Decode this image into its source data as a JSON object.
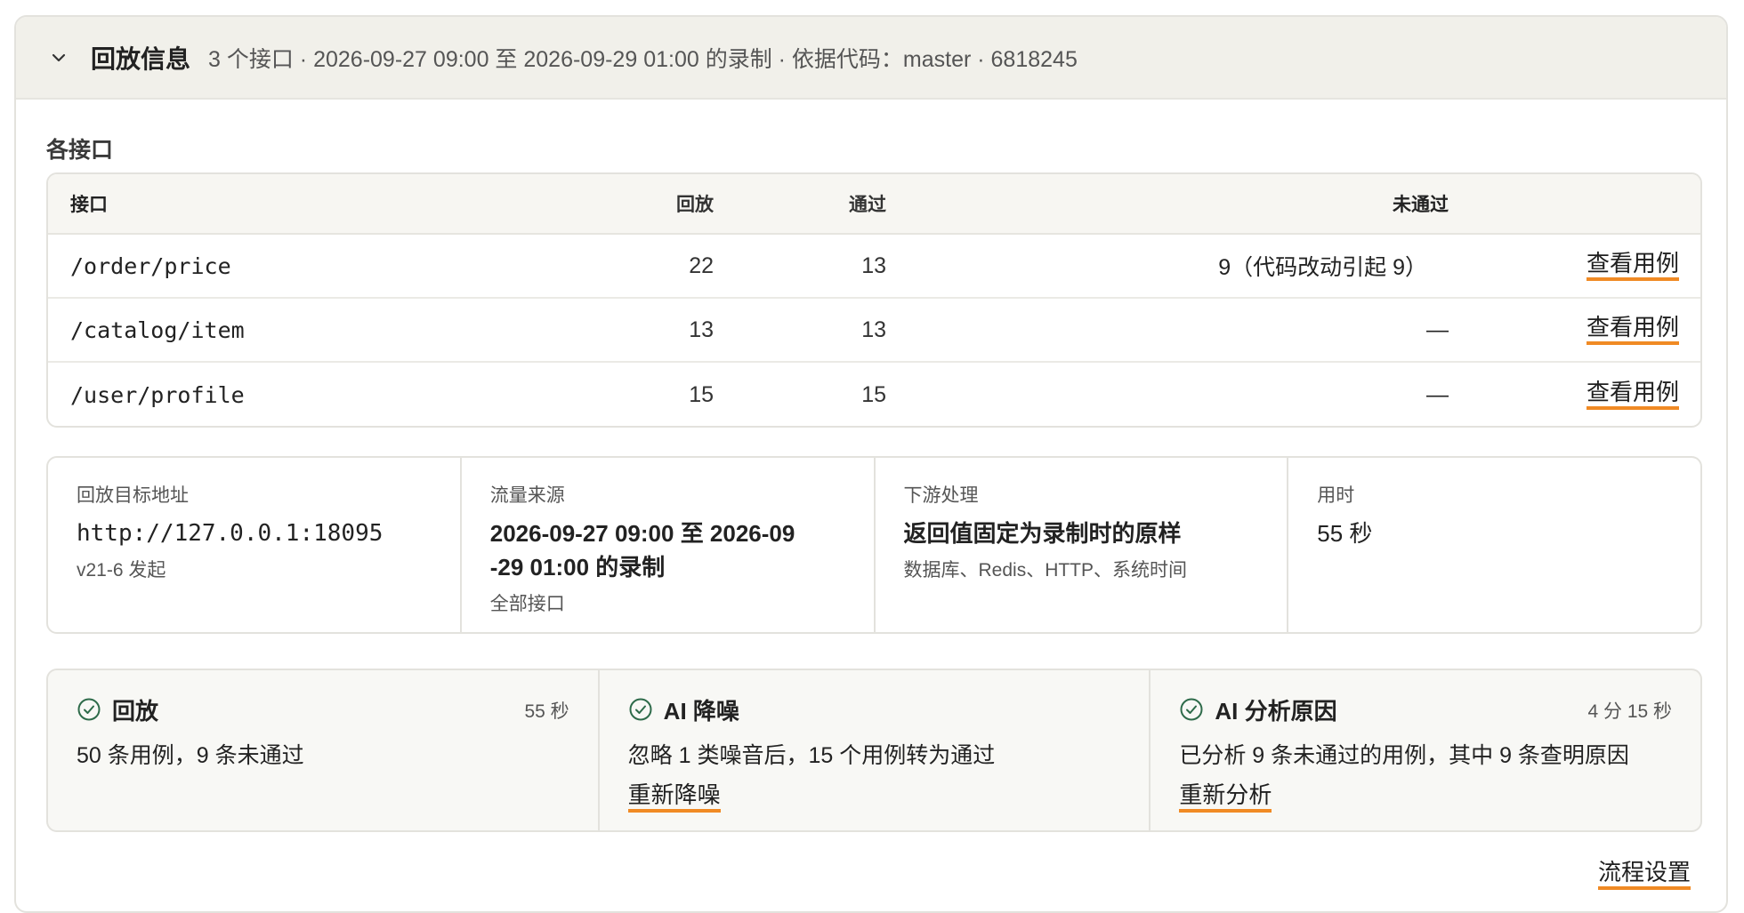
{
  "header": {
    "title": "回放信息",
    "subtitle": "3 个接口 · 2026-09-27 09:00 至 2026-09-29 01:00 的录制 · 依据代码：master · 6818245"
  },
  "apis_section": {
    "label": "各接口",
    "columns": [
      "接口",
      "回放",
      "通过",
      "未通过"
    ],
    "rows": [
      {
        "api": "/order/price",
        "replay": "22",
        "pass": "13",
        "fail": "9（代码改动引起 9）",
        "action": "查看用例"
      },
      {
        "api": "/catalog/item",
        "replay": "13",
        "pass": "13",
        "fail": "—",
        "action": "查看用例"
      },
      {
        "api": "/user/profile",
        "replay": "15",
        "pass": "15",
        "fail": "—",
        "action": "查看用例"
      }
    ]
  },
  "info": {
    "target": {
      "label": "回放目标地址",
      "value": "http://127.0.0.1:18095",
      "sub": "v21-6 发起"
    },
    "source": {
      "label": "流量来源",
      "value_line1": "2026-09-27 09:00 至 2026-09",
      "value_line2": "-29 01:00 的录制",
      "sub": "全部接口"
    },
    "downstream": {
      "label": "下游处理",
      "value": "返回值固定为录制时的原样",
      "sub": "数据库、Redis、HTTP、系统时间"
    },
    "duration": {
      "label": "用时",
      "value": "55 秒"
    }
  },
  "steps": [
    {
      "title": "回放",
      "time": "55 秒",
      "desc": "50 条用例，9 条未通过",
      "action": ""
    },
    {
      "title": "AI 降噪",
      "time": "",
      "desc": "忽略 1 类噪音后，15 个用例转为通过",
      "action": "重新降噪"
    },
    {
      "title": "AI 分析原因",
      "time": "4 分 15 秒",
      "desc": "已分析 9 条未通过的用例，其中 9 条查明原因",
      "action": "重新分析"
    }
  ],
  "footer": {
    "settings_label": "流程设置"
  },
  "colors": {
    "accent": "#f08a24",
    "success": "#2e6b4a",
    "header_bg": "#f1f0ea"
  }
}
